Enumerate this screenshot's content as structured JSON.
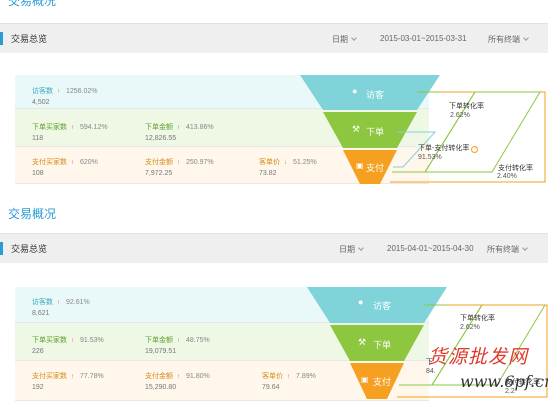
{
  "sections": [
    {
      "page_title": "交易概况",
      "panel_title": "交易总览",
      "date_label": "日期",
      "date_range": "2015-03-01~2015-03-31",
      "terminal": "所有终端",
      "visitors": {
        "label": "访客数",
        "pct": "1256.02%",
        "value": "4,502",
        "trend": "up"
      },
      "order_buyers": {
        "label": "下单买家数",
        "pct": "594.12%",
        "value": "118",
        "trend": "up"
      },
      "order_amount": {
        "label": "下单金额",
        "pct": "413.86%",
        "value": "12,826.55",
        "trend": "up"
      },
      "pay_buyers": {
        "label": "支付买家数",
        "pct": "620%",
        "value": "108",
        "trend": "up"
      },
      "pay_amount": {
        "label": "支付金额",
        "pct": "250.97%",
        "value": "7,972.25",
        "trend": "up"
      },
      "unit_price": {
        "label": "客单价",
        "pct": "51.25%",
        "value": "73.82",
        "trend": "down"
      },
      "funnel": {
        "visitor": "访客",
        "order": "下单",
        "pay": "支付"
      },
      "rates": {
        "order_rate_label": "下单转化率",
        "order_rate": "2.62%",
        "order_pay_label": "下单-支付转化率",
        "order_pay": "91.53%",
        "pay_rate_label": "支付转化率",
        "pay_rate": "2.40%"
      }
    },
    {
      "page_title": "交易概况",
      "panel_title": "交易总览",
      "date_label": "日期",
      "date_range": "2015-04-01~2015-04-30",
      "terminal": "所有终端",
      "visitors": {
        "label": "访客数",
        "pct": "92.61%",
        "value": "8,621",
        "trend": "up"
      },
      "order_buyers": {
        "label": "下单买家数",
        "pct": "91.53%",
        "value": "226",
        "trend": "up"
      },
      "order_amount": {
        "label": "下单金额",
        "pct": "48.75%",
        "value": "19,079.51",
        "trend": "up"
      },
      "pay_buyers": {
        "label": "支付买家数",
        "pct": "77.78%",
        "value": "192",
        "trend": "up"
      },
      "pay_amount": {
        "label": "支付金额",
        "pct": "91.80%",
        "value": "15,290.80",
        "trend": "up"
      },
      "unit_price": {
        "label": "客单价",
        "pct": "7.89%",
        "value": "79.64",
        "trend": "up"
      },
      "funnel": {
        "visitor": "访客",
        "order": "下单",
        "pay": "支付"
      },
      "rates": {
        "order_rate_label": "下单转化率",
        "order_rate": "2.62%",
        "order_pay_label": "下",
        "order_pay": "84.",
        "pay_rate_label": "支付转化率",
        "pay_rate": "2.2"
      }
    }
  ],
  "watermark": {
    "text": "货源批发网",
    "url": "www.6pf.cn"
  },
  "colors": {
    "teal": "#7fd3d9",
    "green": "#8dc63f",
    "orange": "#f5a021",
    "accent": "#2a9bd6",
    "up": "#e5473c",
    "down": "#3aa832"
  }
}
